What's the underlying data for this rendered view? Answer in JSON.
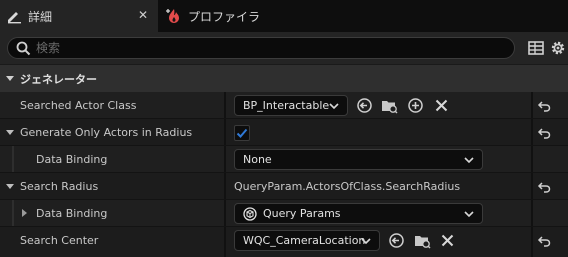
{
  "tabs": [
    {
      "label": "詳細",
      "active": true
    },
    {
      "label": "プロファイラ",
      "active": false
    }
  ],
  "search": {
    "placeholder": "検索",
    "value": ""
  },
  "section": {
    "label": "ジェネレーター"
  },
  "rows": {
    "searched_actor_class": {
      "label": "Searched Actor Class",
      "value": "BP_Interactable"
    },
    "generate_only_in_radius": {
      "label": "Generate Only Actors in Radius",
      "checked": true
    },
    "data_binding_1": {
      "label": "Data Binding",
      "value": "None"
    },
    "search_radius": {
      "label": "Search Radius",
      "value": "QueryParam.ActorsOfClass.SearchRadius"
    },
    "data_binding_2": {
      "label": "Data Binding",
      "value": "Query Params"
    },
    "search_center": {
      "label": "Search Center",
      "value": "WQC_CameraLocation"
    }
  },
  "colors": {
    "accent": "#2f79d6",
    "background": "#151515",
    "row": "#1f1f1f",
    "section": "#2f2f2f"
  }
}
